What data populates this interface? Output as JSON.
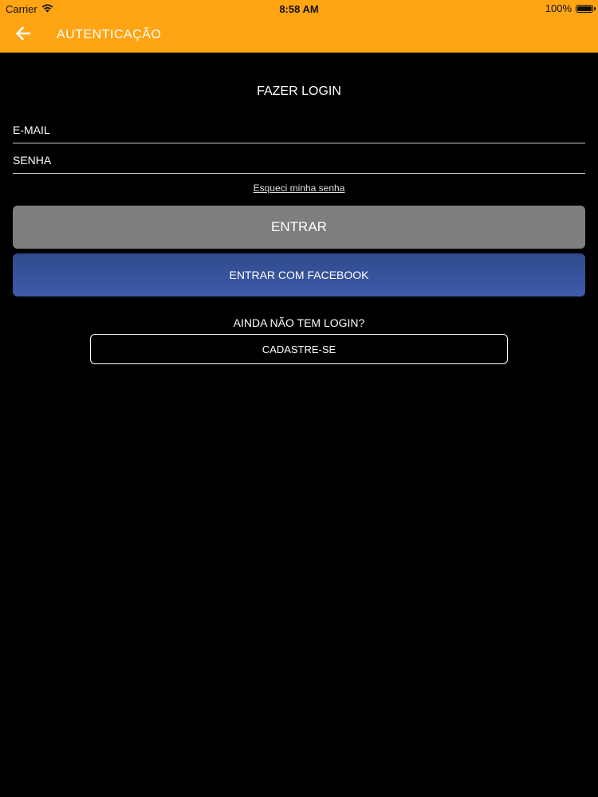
{
  "status_bar": {
    "carrier": "Carrier",
    "time": "8:58 AM",
    "battery_label": "100%",
    "battery_level": 1.0
  },
  "nav": {
    "title": "AUTENTICAÇÃO",
    "back_icon": "arrow-left-icon"
  },
  "login": {
    "title": "FAZER LOGIN",
    "email_placeholder": "E-MAIL",
    "password_placeholder": "SENHA",
    "forgot_password": "Esqueci minha senha",
    "submit_label": "ENTRAR",
    "facebook_label": "ENTRAR COM FACEBOOK"
  },
  "register": {
    "prompt": "AINDA NÃO TEM LOGIN?",
    "button_label": "CADASTRE-SE"
  },
  "colors": {
    "header": "#FFA412",
    "background": "#000000",
    "login_button": "#7E7E7E",
    "facebook_button": "#3B5998"
  }
}
